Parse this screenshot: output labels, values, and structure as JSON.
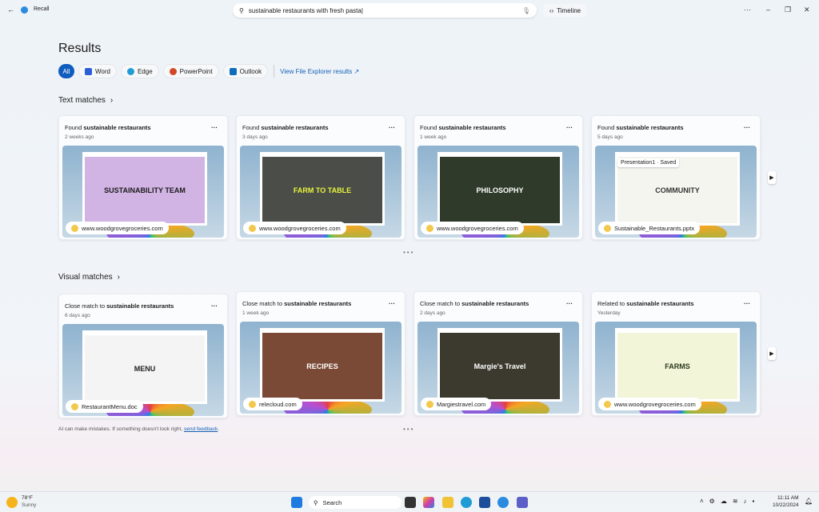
{
  "app": {
    "title": "Recall",
    "search_value": "sustainable restaurants with fresh pasta",
    "timeline_label": "Timeline"
  },
  "page": {
    "title": "Results",
    "filters": [
      {
        "label": "All",
        "active": true
      },
      {
        "label": "Word",
        "color": "#2b5fd9"
      },
      {
        "label": "Edge",
        "color": "#1f9bd6"
      },
      {
        "label": "PowerPoint",
        "color": "#d24726"
      },
      {
        "label": "Outlook",
        "color": "#0f6cbd"
      }
    ],
    "file_explorer_link": "View File Explorer results"
  },
  "text_matches": {
    "heading": "Text matches",
    "cards": [
      {
        "prefix": "Found",
        "term": "sustainable restaurants",
        "time": "2 weeks ago",
        "source": "www.woodgrovegroceries.com",
        "screen_title": "SUSTAINABILITY TEAM",
        "screen_bg": "#d2b4e4",
        "screen_fg": "#1b1b1b"
      },
      {
        "prefix": "Found",
        "term": "sustainable restaurants",
        "time": "3 days ago",
        "source": "www.woodgrovegroceries.com",
        "screen_title": "FARM TO TABLE",
        "screen_bg": "#4a4d48",
        "screen_fg": "#e9f53c"
      },
      {
        "prefix": "Found",
        "term": "sustainable restaurants",
        "time": "1 week ago",
        "source": "www.woodgrovegroceries.com",
        "screen_title": "PHILOSOPHY",
        "screen_bg": "#2f3a2a",
        "screen_fg": "#ffffff"
      },
      {
        "prefix": "Found",
        "term": "sustainable restaurants",
        "time": "5 days ago",
        "source": "Sustainable_Restaurants.pptx",
        "screen_title": "COMMUNITY",
        "screen_bg": "#f5f5f0",
        "screen_fg": "#333333",
        "tooltip": "Presentation1 · Saved"
      }
    ]
  },
  "visual_matches": {
    "heading": "Visual matches",
    "cards": [
      {
        "prefix": "Close match to",
        "term": "sustainable restaurants",
        "time": "6 days ago",
        "source": "RestaurantMenu.doc",
        "screen_title": "MENU",
        "screen_bg": "#f4f4f4",
        "screen_fg": "#222222"
      },
      {
        "prefix": "Close match to",
        "term": "sustainable restaurants",
        "time": "1 week ago",
        "source": "relecloud.com",
        "screen_title": "RECIPES",
        "screen_bg": "#7a4a36",
        "screen_fg": "#ffffff"
      },
      {
        "prefix": "Close match to",
        "term": "sustainable restaurants",
        "time": "2 days ago",
        "source": "Margiestravel.com",
        "screen_title": "Margie's Travel",
        "screen_bg": "#3c3a2e",
        "screen_fg": "#ffffff"
      },
      {
        "prefix": "Related to",
        "term": "sustainable restaurants",
        "time": "Yesterday",
        "source": "www.woodgrovegroceries.com",
        "screen_title": "FARMS",
        "screen_bg": "#f2f5d8",
        "screen_fg": "#2d3a1f"
      }
    ]
  },
  "footer": {
    "disclaimer": "AI can make mistakes. If something doesn't look right,",
    "feedback_link": "send feedback",
    "period": "."
  },
  "taskbar": {
    "weather_temp": "78°F",
    "weather_desc": "Sunny",
    "search_label": "Search",
    "time": "11:11 AM",
    "date": "10/22/2024"
  }
}
